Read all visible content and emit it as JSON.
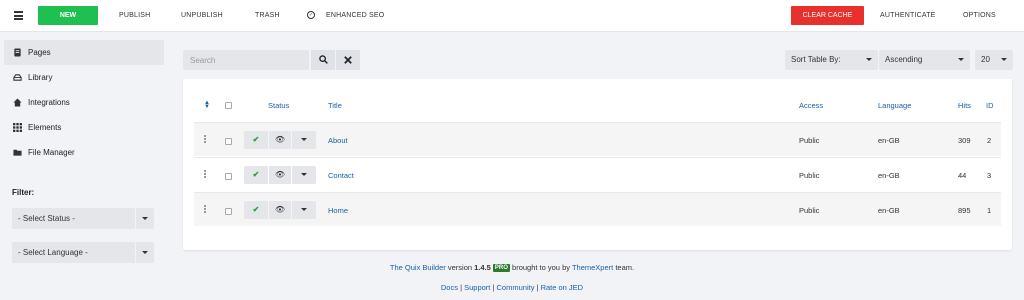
{
  "topbar": {
    "new_label": "NEW",
    "publish_label": "PUBLISH",
    "unpublish_label": "UNPUBLISH",
    "trash_label": "TRASH",
    "seo_label": "ENHANCED SEO",
    "clear_cache_label": "CLEAR CACHE",
    "authenticate_label": "AUTHENTICATE",
    "options_label": "OPTIONS"
  },
  "sidebar": {
    "items": [
      {
        "label": "Pages",
        "icon": "pages-icon"
      },
      {
        "label": "Library",
        "icon": "library-icon"
      },
      {
        "label": "Integrations",
        "icon": "integrations-icon"
      },
      {
        "label": "Elements",
        "icon": "elements-icon"
      },
      {
        "label": "File Manager",
        "icon": "folder-icon"
      }
    ],
    "filter_label": "Filter:",
    "status_select": "- Select Status -",
    "language_select": "- Select Language -"
  },
  "toolbar": {
    "search_placeholder": "Search",
    "sort_label": "Sort Table By:",
    "order_value": "Ascending",
    "limit_value": "20"
  },
  "table": {
    "headers": {
      "status": "Status",
      "title": "Title",
      "access": "Access",
      "language": "Language",
      "hits": "Hits",
      "id": "ID"
    },
    "rows": [
      {
        "title": "About",
        "access": "Public",
        "language": "en-GB",
        "hits": "309",
        "id": "2"
      },
      {
        "title": "Contact",
        "access": "Public",
        "language": "en-GB",
        "hits": "44",
        "id": "3"
      },
      {
        "title": "Home",
        "access": "Public",
        "language": "en-GB",
        "hits": "895",
        "id": "1"
      }
    ]
  },
  "footer": {
    "product_link": "The Quix Builder",
    "version_text": "version",
    "version": "1.4.5",
    "pro_badge": "PRO",
    "brought_text": "brought to you by",
    "company_link": "ThemeXpert",
    "team_text": "team.",
    "links": [
      "Docs",
      "Support",
      "Community",
      "Rate on JED"
    ]
  },
  "colors": {
    "new_button": "#1fbf52",
    "clear_cache_button": "#e8312d",
    "link": "#1a5fa8",
    "published_check": "#2a9d3a"
  }
}
